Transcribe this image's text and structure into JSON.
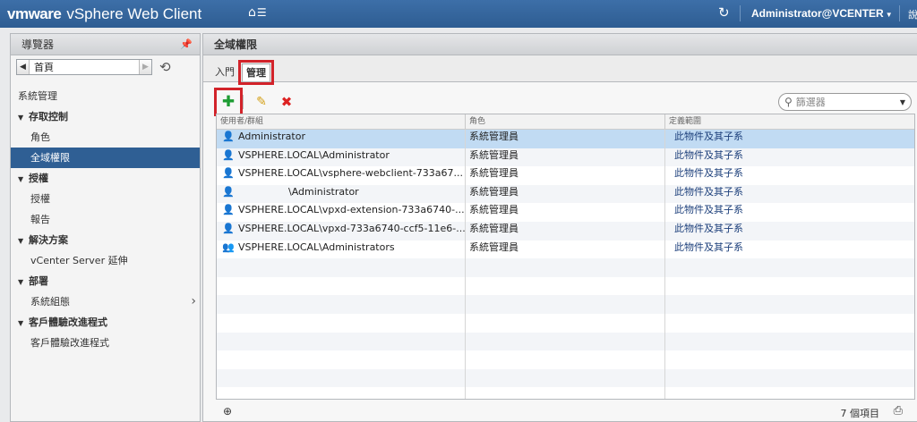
{
  "header": {
    "brand_vm": "vmware",
    "brand_product": "vSphere Web Client",
    "user": "Administrator@VCENTER",
    "more": "說"
  },
  "navigator": {
    "title": "導覽器",
    "history_label": "首頁",
    "items": [
      {
        "label": "系統管理",
        "kind": "section"
      },
      {
        "label": "存取控制",
        "kind": "group"
      },
      {
        "label": "角色",
        "kind": "child"
      },
      {
        "label": "全域權限",
        "kind": "child",
        "selected": true
      },
      {
        "label": "授權",
        "kind": "group"
      },
      {
        "label": "授權",
        "kind": "child"
      },
      {
        "label": "報告",
        "kind": "child"
      },
      {
        "label": "解決方案",
        "kind": "group"
      },
      {
        "label": "vCenter Server 延伸",
        "kind": "child"
      },
      {
        "label": "部署",
        "kind": "group"
      },
      {
        "label": "系統組態",
        "kind": "child",
        "chevron": true
      },
      {
        "label": "客戶體驗改進程式",
        "kind": "group"
      },
      {
        "label": "客戶體驗改進程式",
        "kind": "child"
      }
    ]
  },
  "main": {
    "title": "全域權限",
    "tabs": [
      {
        "label": "入門",
        "active": false
      },
      {
        "label": "管理",
        "active": true
      }
    ],
    "filter_placeholder": "篩選器",
    "columns": [
      "使用者/群組",
      "角色",
      "定義範圍"
    ],
    "rows": [
      {
        "user": "Administrator",
        "role": "系統管理員",
        "scope": "此物件及其子系",
        "icon": "user-icon",
        "selected": true
      },
      {
        "user": "VSPHERE.LOCAL\\Administrator",
        "role": "系統管理員",
        "scope": "此物件及其子系",
        "icon": "user-icon"
      },
      {
        "user": "VSPHERE.LOCAL\\vsphere-webclient-733a67...",
        "role": "系統管理員",
        "scope": "此物件及其子系",
        "icon": "user-icon"
      },
      {
        "user": "\\Administrator",
        "role": "系統管理員",
        "scope": "此物件及其子系",
        "icon": "user-icon",
        "indent": true
      },
      {
        "user": "VSPHERE.LOCAL\\vpxd-extension-733a6740-...",
        "role": "系統管理員",
        "scope": "此物件及其子系",
        "icon": "user-icon"
      },
      {
        "user": "VSPHERE.LOCAL\\vpxd-733a6740-ccf5-11e6-...",
        "role": "系統管理員",
        "scope": "此物件及其子系",
        "icon": "user-icon"
      },
      {
        "user": "VSPHERE.LOCAL\\Administrators",
        "role": "系統管理員",
        "scope": "此物件及其子系",
        "icon": "group-icon"
      }
    ],
    "empty_rows": 8,
    "item_count": "7 個項目"
  },
  "colors": {
    "header_bg": "#2e5d92",
    "selected_nav": "#2f5f94",
    "selected_row": "#c1dbf3",
    "highlight_box": "#d2232a",
    "add_green": "#1e9c33",
    "delete_red": "#dd2222"
  }
}
